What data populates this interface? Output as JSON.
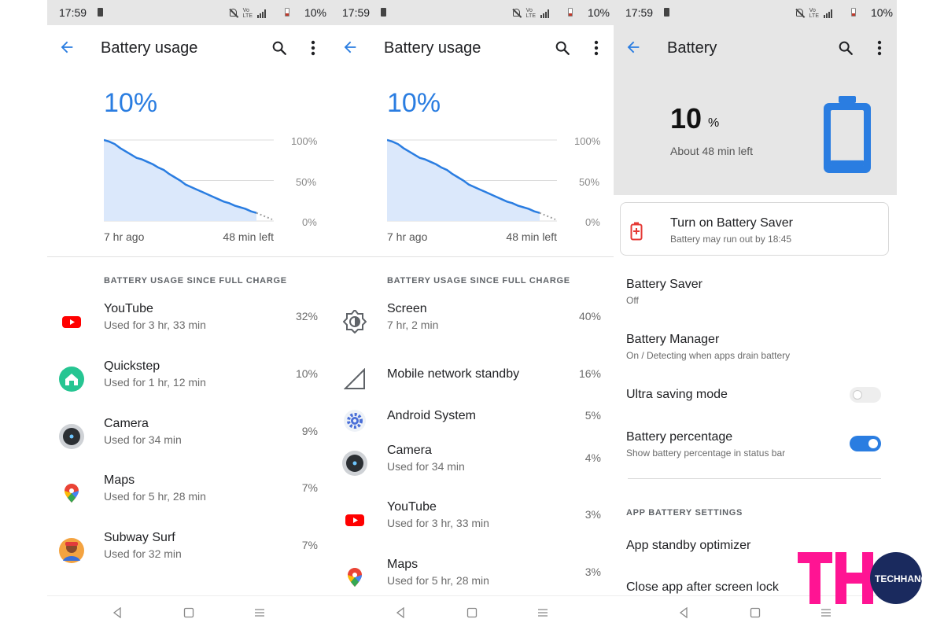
{
  "status": {
    "time": "17:59",
    "battery": "10%",
    "network": "4G",
    "volte": "VoLTE"
  },
  "colors": {
    "accent": "#2a7de1",
    "divider": "#e0e0e0",
    "header_bg": "#e6e6e6",
    "youtube_red": "#ff0000",
    "battery_blue": "#2a7de1",
    "watermark_pink": "#ff1493",
    "watermark_navy": "#1a2a5e"
  },
  "icons": {
    "back": "arrow-back-icon",
    "search": "search-icon",
    "menu": "more-vert-icon"
  },
  "usage_left": {
    "title": "Battery usage",
    "level": "10%",
    "graph": {
      "labels": [
        "100%",
        "50%",
        "0%"
      ],
      "start": "7 hr ago",
      "end": "48 min left",
      "levels_pct": [
        100,
        98,
        95,
        90,
        86,
        82,
        78,
        76,
        73,
        70,
        66,
        63,
        58,
        54,
        50,
        45,
        42,
        39,
        36,
        33,
        30,
        27,
        24,
        22,
        19,
        17,
        15,
        12,
        10
      ]
    },
    "section": "BATTERY USAGE SINCE FULL CHARGE",
    "items": [
      {
        "name": "YouTube",
        "sub": "Used for 3 hr, 33 min",
        "pct": "32%",
        "icon": "youtube-icon"
      },
      {
        "name": "Quickstep",
        "sub": "Used for 1 hr, 12 min",
        "pct": "10%",
        "icon": "quickstep-icon"
      },
      {
        "name": "Camera",
        "sub": "Used for 34 min",
        "pct": "9%",
        "icon": "camera-icon"
      },
      {
        "name": "Maps",
        "sub": "Used for 5 hr, 28 min",
        "pct": "7%",
        "icon": "maps-pin-icon"
      },
      {
        "name": "Subway Surf",
        "sub": "Used for 32 min",
        "pct": "7%",
        "icon": "subway-surf-icon"
      }
    ]
  },
  "usage_right": {
    "title": "Battery usage",
    "level": "10%",
    "graph": {
      "labels": [
        "100%",
        "50%",
        "0%"
      ],
      "start": "7 hr ago",
      "end": "48 min left",
      "levels_pct": [
        100,
        98,
        95,
        90,
        86,
        82,
        78,
        76,
        73,
        70,
        66,
        63,
        58,
        54,
        50,
        45,
        42,
        39,
        36,
        33,
        30,
        27,
        24,
        22,
        19,
        17,
        15,
        12,
        10
      ]
    },
    "section": "BATTERY USAGE SINCE FULL CHARGE",
    "items": [
      {
        "name": "Screen",
        "sub": "7 hr, 2 min",
        "pct": "40%",
        "icon": "brightness-icon"
      },
      {
        "name": "Mobile network standby",
        "sub": "",
        "pct": "16%",
        "icon": "signal-icon"
      },
      {
        "name": "Android System",
        "sub": "",
        "pct": "5%",
        "icon": "android-system-gear-icon"
      },
      {
        "name": "Camera",
        "sub": "Used for 34 min",
        "pct": "4%",
        "icon": "camera-icon"
      },
      {
        "name": "YouTube",
        "sub": "Used for 3 hr, 33 min",
        "pct": "3%",
        "icon": "youtube-icon"
      },
      {
        "name": "Maps",
        "sub": "Used for 5 hr, 28 min",
        "pct": "3%",
        "icon": "maps-pin-icon"
      }
    ]
  },
  "battery_settings": {
    "title": "Battery",
    "level_value": "10",
    "level_unit": "%",
    "remaining": "About 48 min left",
    "battery_fill_level": 0.1,
    "saver_card": {
      "title": "Turn on Battery Saver",
      "sub": "Battery may run out by 18:45"
    },
    "settings": [
      {
        "name": "Battery Saver",
        "sub": "Off"
      },
      {
        "name": "Battery Manager",
        "sub": "On / Detecting when apps drain battery"
      },
      {
        "name": "Ultra saving mode",
        "toggle": false
      },
      {
        "name": "Battery percentage",
        "sub": "Show battery percentage in status bar",
        "toggle": true
      }
    ],
    "section": "APP BATTERY SETTINGS",
    "app_items": [
      "App standby optimizer",
      "Close app after screen lock"
    ]
  },
  "watermark": {
    "logo": "TH",
    "text": "TECHHANGOUT"
  }
}
